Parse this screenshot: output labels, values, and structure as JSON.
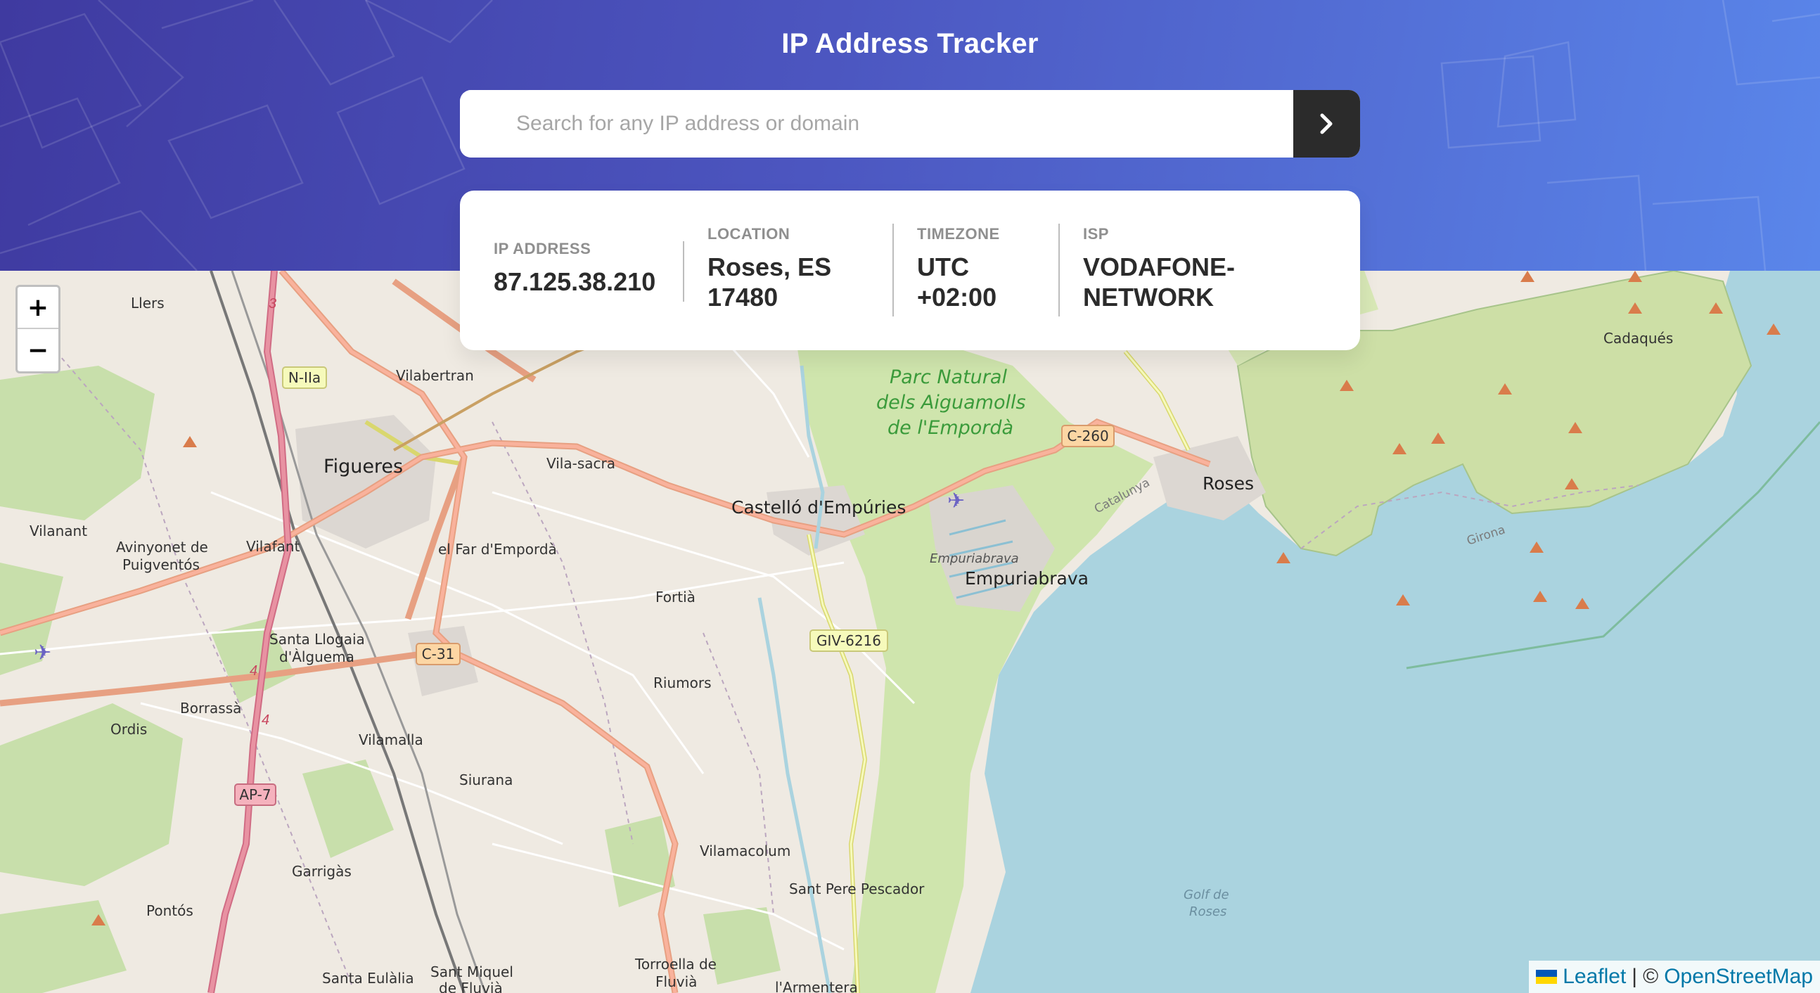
{
  "app": {
    "title": "IP Address Tracker"
  },
  "search": {
    "placeholder": "Search for any IP address or domain",
    "value": "",
    "submit_icon": "chevron-right-icon"
  },
  "info": {
    "ip": {
      "label": "IP ADDRESS",
      "value": "87.125.38.210"
    },
    "location": {
      "label": "LOCATION",
      "value_line1": "Roses, ES",
      "value_line2": "17480"
    },
    "timezone": {
      "label": "TIMEZONE",
      "value_line1": "UTC",
      "value_line2": "+02:00"
    },
    "isp": {
      "label": "ISP",
      "value_line1": "VODAFONE-",
      "value_line2": "NETWORK"
    }
  },
  "map": {
    "zoom_in": "+",
    "zoom_out": "−",
    "attribution": {
      "leaflet": "Leaflet",
      "separator": "|",
      "copyright": "©",
      "osm": "OpenStreetMap"
    },
    "places": {
      "llers": "Llers",
      "vilabertran": "Vilabertran",
      "figueres": "Figueres",
      "vila_sacra": "Vila-sacra",
      "castello": "Castelló d'Empúries",
      "parc1": "Parc Natural",
      "parc2": "dels Aiguamolls",
      "parc3": "de l'Empordà",
      "roses": "Roses",
      "cadaques": "Cadaqués",
      "vilanant": "Vilanant",
      "avinyonet1": "Avinyonet de",
      "avinyonet2": "Puigventós",
      "vilafant": "Vilafant",
      "far": "el Far d'Empordà",
      "fortia": "Fortià",
      "empuriabrava_small": "Empuriabrava",
      "empuriabrava": "Empuriabrava",
      "santa_llogaia1": "Santa Llogaia",
      "santa_llogaia2": "d'Àlguema",
      "borrassa": "Borrassà",
      "ordis": "Ordis",
      "riumors": "Riumors",
      "vilamalla": "Vilamalla",
      "siurana": "Siurana",
      "garrigas": "Garrigàs",
      "vilamacolum": "Vilamacolum",
      "sant_pere": "Sant Pere Pescador",
      "pontos": "Pontós",
      "santa_eulalia": "Santa Eulàlia",
      "sant_miquel1": "Sant Miquel",
      "sant_miquel2": "de Fluvià",
      "torroella1": "Torroella de",
      "torroella2": "Fluvià",
      "armentera": "l'Armentera",
      "golf1": "Golf de",
      "golf2": "Roses",
      "catalunya": "Catalunya",
      "girona": "Girona"
    },
    "road_labels": {
      "n2a": "N-IIa",
      "c260": "C-260",
      "c31": "C-31",
      "giv": "GIV-6216",
      "ap7": "AP-7",
      "r3": "3",
      "r4a": "4",
      "r4b": "4"
    }
  },
  "colors": {
    "header_start": "#3f3aa0",
    "header_end": "#5a86ea",
    "submit_button": "#2b2b2b",
    "sea": "#aad3df",
    "land": "#efeae2",
    "park": "#cddfa6",
    "highway": "#e892a2",
    "trunk": "#f0a584",
    "secondary": "#f6fabb"
  }
}
